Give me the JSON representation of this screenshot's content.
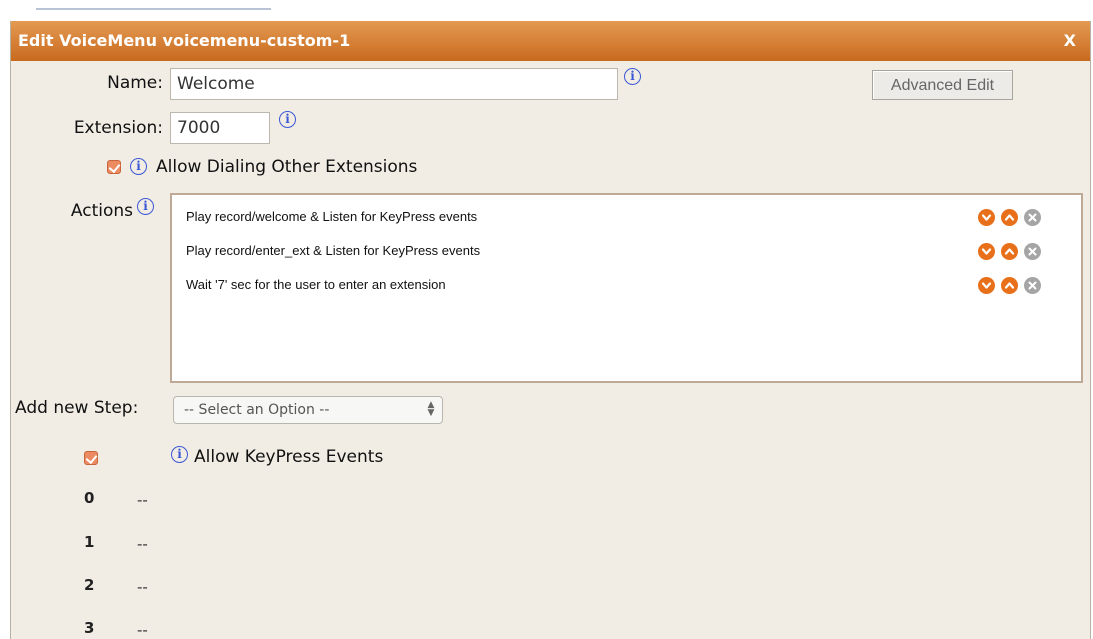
{
  "dialog": {
    "title": "Edit VoiceMenu voicemenu-custom-1",
    "close_label": "X"
  },
  "form": {
    "name_label": "Name:",
    "name_value": "Welcome",
    "extension_label": "Extension:",
    "extension_value": "7000",
    "allow_dialing_label": "Allow Dialing Other Extensions",
    "allow_dialing_checked": true,
    "advanced_edit_label": "Advanced Edit",
    "actions_label": "Actions",
    "add_step_label": "Add new Step:",
    "add_step_select": "-- Select an Option --",
    "allow_keypress_label": "Allow KeyPress Events",
    "allow_keypress_checked": true
  },
  "actions": [
    {
      "text": "Play record/welcome & Listen for KeyPress events"
    },
    {
      "text": "Play record/enter_ext & Listen for KeyPress events"
    },
    {
      "text": "Wait '7' sec for the user to enter an extension"
    }
  ],
  "keypress": [
    {
      "digit": "0",
      "value": "--"
    },
    {
      "digit": "1",
      "value": "--"
    },
    {
      "digit": "2",
      "value": "--"
    },
    {
      "digit": "3",
      "value": "--"
    }
  ],
  "colors": {
    "titlebar": "#d4792b",
    "accent_button": "#e8701a",
    "remove_button": "#a5a5a5",
    "info_icon": "#3b57d6",
    "panel_bg": "#f1ede4"
  },
  "icons": {
    "info": "info-icon",
    "move_down": "chevron-down-icon",
    "move_up": "chevron-up-icon",
    "remove": "close-icon"
  }
}
